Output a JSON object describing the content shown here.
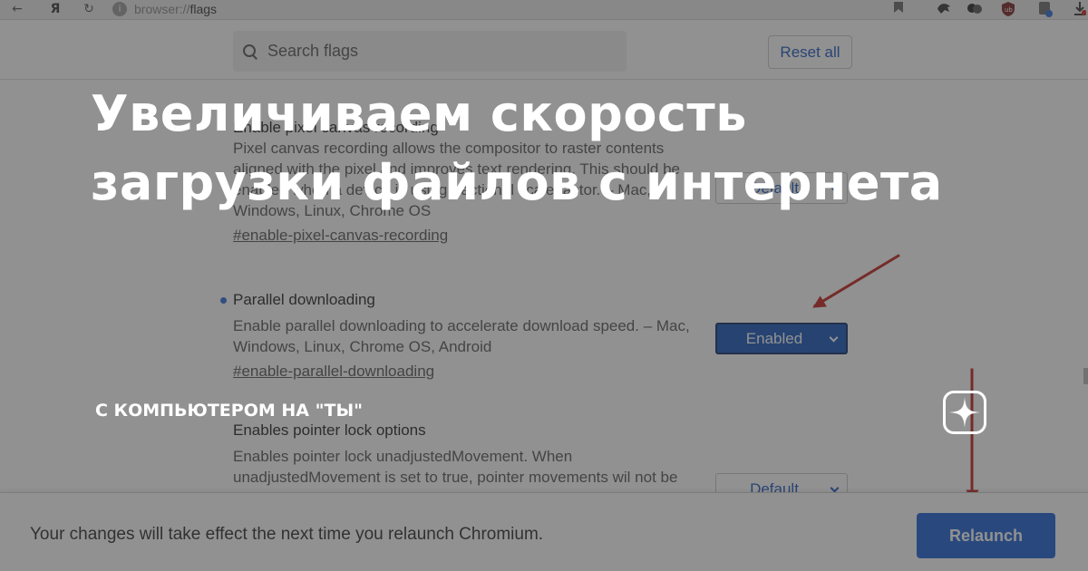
{
  "browser": {
    "url_scheme": "browser://",
    "url_path": "flags",
    "icons": {
      "back": "arrow-left-icon",
      "yandex": "yandex-logo-icon",
      "reload": "reload-icon",
      "info": "site-info-icon",
      "bookmark": "bookmark-icon",
      "ext1": "extension-icon",
      "ext2": "extension-icon",
      "ublock": "ublock-icon",
      "ext4": "extension-icon",
      "download": "download-icon"
    }
  },
  "header": {
    "search_placeholder": "Search flags",
    "reset_label": "Reset all"
  },
  "flags": [
    {
      "title": "Enable pixel canvas recording",
      "description": "Pixel canvas recording allows the compositor to raster contents aligned with the pixel and improves text rendering. This should be enabled when a device is using fractional scale factor. – Mac, Windows, Linux, Chrome OS",
      "link": "#enable-pixel-canvas-recording",
      "select_value": "Default",
      "modified": false
    },
    {
      "title": "Parallel downloading",
      "description": "Enable parallel downloading to accelerate download speed. – Mac, Windows, Linux, Chrome OS, Android",
      "link": "#enable-parallel-downloading",
      "select_value": "Enabled",
      "modified": true
    },
    {
      "title": "Enables pointer lock options",
      "description": "Enables pointer lock unadjustedMovement. When unadjustedMovement is set to true, pointer movements wil not be",
      "link": "",
      "select_value": "Default",
      "modified": false
    }
  ],
  "bottom_bar": {
    "message": "Your changes will take effect the next time you relaunch Chromium.",
    "relaunch_label": "Relaunch"
  },
  "overlay": {
    "headline_line1": "Увеличиваем скорость",
    "headline_line2": "загрузки файлов с интернета",
    "channel": "С КОМПЬЮТЕРОМ НА \"ТЫ\"",
    "logo_icon": "zen-star-icon"
  },
  "colors": {
    "accent_blue": "#1a5fd4",
    "enabled_select": "#1353ba",
    "arrow_red": "#c1211b",
    "overlay_dim": "rgba(55,55,55,0.55)"
  }
}
